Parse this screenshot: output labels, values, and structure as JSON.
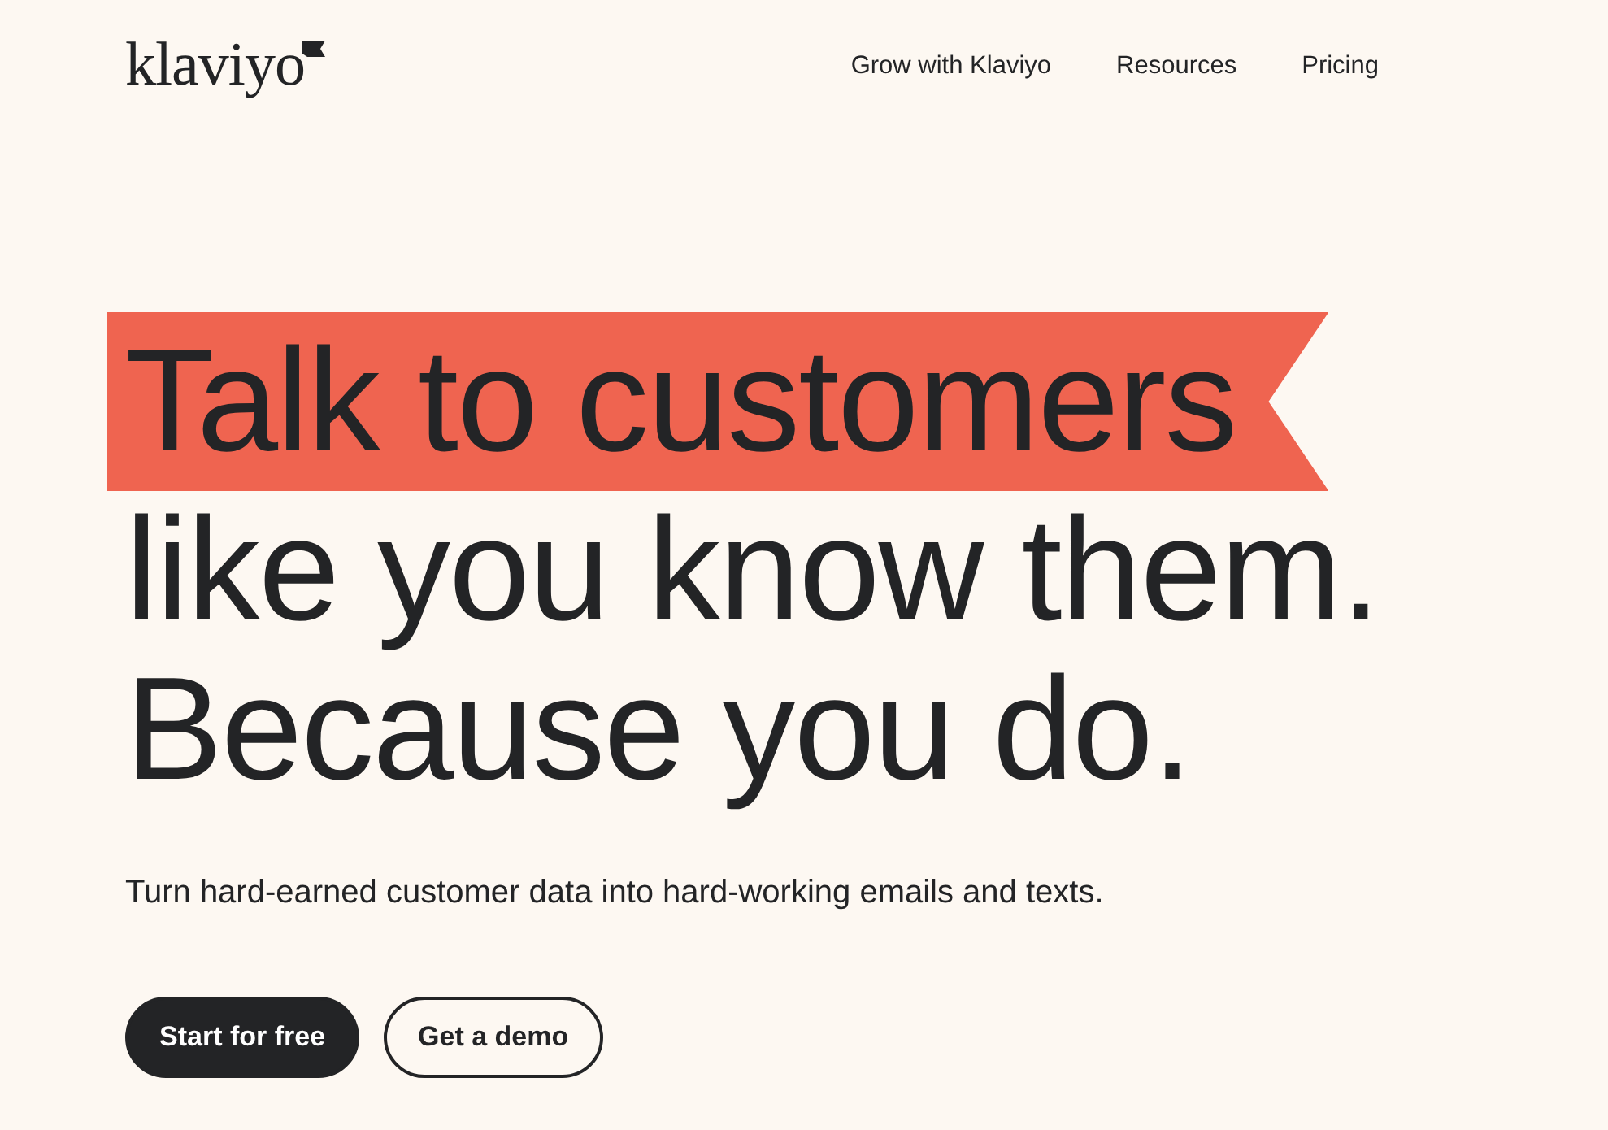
{
  "header": {
    "logo": {
      "text": "klaviyo"
    },
    "nav": [
      {
        "label": "Grow with Klaviyo"
      },
      {
        "label": "Resources"
      },
      {
        "label": "Pricing"
      }
    ]
  },
  "hero": {
    "headline": {
      "highlight": "Talk to customers",
      "lines": [
        "like you know them.",
        "Because you do."
      ]
    },
    "subtitle": "Turn hard-earned customer data into hard-working emails and texts.",
    "buttons": [
      {
        "label": "Start for free",
        "kind": "primary"
      },
      {
        "label": "Get a demo",
        "kind": "secondary"
      }
    ]
  }
}
